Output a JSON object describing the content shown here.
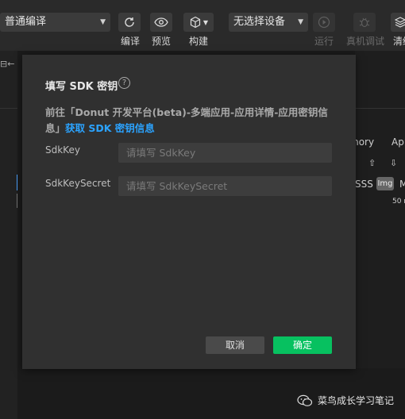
{
  "toolbar": {
    "compile_mode": "普通编译",
    "device": "无选择设备",
    "labels": {
      "compile": "编译",
      "preview": "预览",
      "build": "构建",
      "run": "运行",
      "real_debug": "真机调试",
      "clear": "清缓"
    }
  },
  "background": {
    "tab_memory": "mory",
    "tab_app": "Apr",
    "filter_css": "SSS",
    "filter_img": "Img",
    "filter_m": "M",
    "size_value": "50 r"
  },
  "modal": {
    "title": "填写 SDK 密钥",
    "help_icon": "?",
    "description_prefix": "前往「Donut 开发平台(beta)-多端应用-应用详情-应用密钥信息」",
    "description_link": "获取 SDK 密钥信息",
    "fields": [
      {
        "label": "SdkKey",
        "placeholder": "请填写 SdkKey"
      },
      {
        "label": "SdkKeySecret",
        "placeholder": "请填写 SdkKeySecret"
      }
    ],
    "cancel": "取消",
    "confirm": "确定"
  },
  "watermark": {
    "text": "菜鸟成长学习笔记",
    "icon": "wechat-icon"
  },
  "colors": {
    "accent_green": "#07c160",
    "link_blue": "#2ba3ff",
    "modal_bg": "#303030",
    "toolbar_bg": "#2a2a2a"
  }
}
